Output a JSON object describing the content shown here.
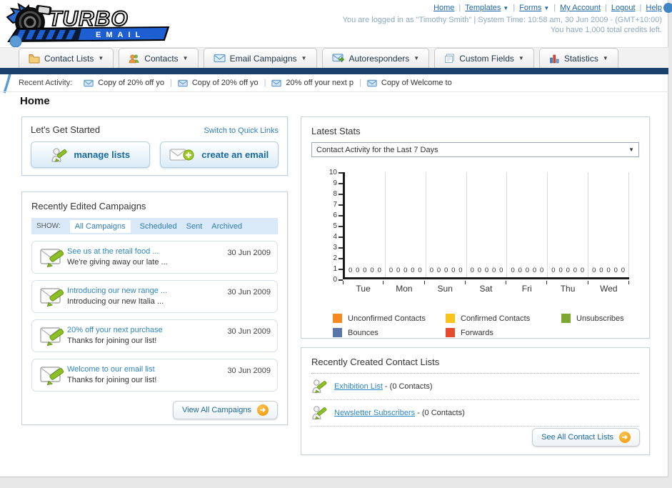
{
  "header": {
    "logo_line1": "TURBO",
    "logo_line2": "EMAIL",
    "nav_links": [
      {
        "label": "Home",
        "dropdown": false
      },
      {
        "label": "Templates",
        "dropdown": true
      },
      {
        "label": "Forms",
        "dropdown": true
      },
      {
        "label": "My Account",
        "dropdown": false
      },
      {
        "label": "Logout",
        "dropdown": false
      },
      {
        "label": "Help",
        "dropdown": false
      }
    ],
    "login_info": "You are logged in as \"Timothy Smith\" | System Time: 10:58 am, 30 Jun 2009 - (GMT+10:00)",
    "credits_info": "You have 1,000 total credits left."
  },
  "nav_tabs": [
    {
      "label": "Contact Lists"
    },
    {
      "label": "Contacts"
    },
    {
      "label": "Email Campaigns"
    },
    {
      "label": "Autoresponders"
    },
    {
      "label": "Custom Fields"
    },
    {
      "label": "Statistics"
    }
  ],
  "recent_activity": {
    "label": "Recent Activity:",
    "items": [
      {
        "text": "Copy of 20% off yo"
      },
      {
        "text": "Copy of 20% off yo"
      },
      {
        "text": "20% off your next p"
      },
      {
        "text": "Copy of Welcome to"
      }
    ]
  },
  "page_title": "Home",
  "get_started": {
    "title": "Let's Get Started",
    "switch_link": "Switch to Quick Links",
    "manage_lists_label": "manage lists",
    "create_email_label": "create an email"
  },
  "campaigns": {
    "title": "Recently Edited Campaigns",
    "show_label": "SHOW:",
    "filters": [
      {
        "label": "All Campaigns"
      },
      {
        "label": "Scheduled"
      },
      {
        "label": "Sent"
      },
      {
        "label": "Archived"
      }
    ],
    "active_filter": "All Campaigns",
    "items": [
      {
        "title": "See us at the retail food ...",
        "subtitle": "We're giving away our late ...",
        "date": "30 Jun 2009"
      },
      {
        "title": "Introducing our new range ...",
        "subtitle": "Introducing our new Italia ...",
        "date": "30 Jun 2009"
      },
      {
        "title": "20% off your next purchase",
        "subtitle": "Thanks for joining our list!",
        "date": "30 Jun 2009"
      },
      {
        "title": "Welcome to our email list",
        "subtitle": "Thanks for joining our list!",
        "date": "30 Jun 2009"
      }
    ],
    "view_all_label": "View All Campaigns"
  },
  "latest_stats": {
    "title": "Latest Stats",
    "dropdown_value": "Contact Activity for the Last 7 Days"
  },
  "chart_data": {
    "type": "bar",
    "title": "Contact Activity for the Last 7 Days",
    "categories": [
      "Tue",
      "Mon",
      "Sun",
      "Sat",
      "Fri",
      "Thu",
      "Wed"
    ],
    "series": [
      {
        "name": "Unconfirmed Contacts",
        "color": "#F6891F",
        "values": [
          0,
          0,
          0,
          0,
          0,
          0,
          0
        ]
      },
      {
        "name": "Confirmed Contacts",
        "color": "#F8C41B",
        "values": [
          0,
          0,
          0,
          0,
          0,
          0,
          0
        ]
      },
      {
        "name": "Unsubscribes",
        "color": "#7CA832",
        "values": [
          0,
          0,
          0,
          0,
          0,
          0,
          0
        ]
      },
      {
        "name": "Bounces",
        "color": "#5A76A8",
        "values": [
          0,
          0,
          0,
          0,
          0,
          0,
          0
        ]
      },
      {
        "name": "Forwards",
        "color": "#E64C2B",
        "values": [
          0,
          0,
          0,
          0,
          0,
          0,
          0
        ]
      }
    ],
    "ylim": [
      0,
      10
    ],
    "y_ticks": [
      0,
      1,
      2,
      3,
      4,
      5,
      6,
      7,
      8,
      9,
      10
    ],
    "data_labels": true,
    "grid": "vertical-group-separators",
    "legend_position": "bottom"
  },
  "contact_lists": {
    "title": "Recently Created Contact Lists",
    "items": [
      {
        "name": "Exhibition List",
        "suffix": " - (0 Contacts)"
      },
      {
        "name": "Newsletter Subscribers",
        "suffix": " - (0 Contacts)"
      }
    ],
    "see_all_label": "See All Contact Lists"
  }
}
